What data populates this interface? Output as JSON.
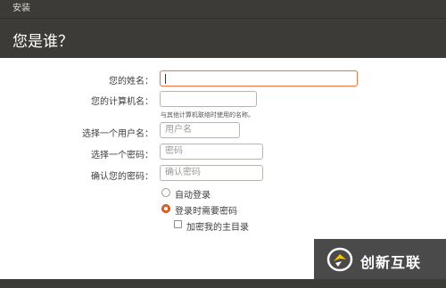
{
  "window": {
    "title": "安装"
  },
  "header": {
    "heading": "您是谁？"
  },
  "form": {
    "name": {
      "label": "您的姓名：",
      "value": ""
    },
    "computer_name": {
      "label": "您的计算机名：",
      "value": "",
      "hint": "与其他计算机联络时使用的名称。"
    },
    "username": {
      "label": "选择一个用户名：",
      "placeholder": "用户名"
    },
    "password": {
      "label": "选择一个密码：",
      "placeholder": "密码"
    },
    "confirm_password": {
      "label": "确认您的密码：",
      "placeholder": "确认密码"
    }
  },
  "login_options": {
    "auto_login": {
      "label": "自动登录",
      "selected": false
    },
    "require_password": {
      "label": "登录时需要密码",
      "selected": true
    },
    "encrypt_home": {
      "label": "加密我的主目录",
      "checked": false
    }
  },
  "watermark": {
    "text": "创新互联",
    "logo_icon": "chuangxin-logo-icon"
  },
  "colors": {
    "accent": "#e0632c",
    "header_bg": "#3c3b37",
    "focus": "#f07746"
  }
}
